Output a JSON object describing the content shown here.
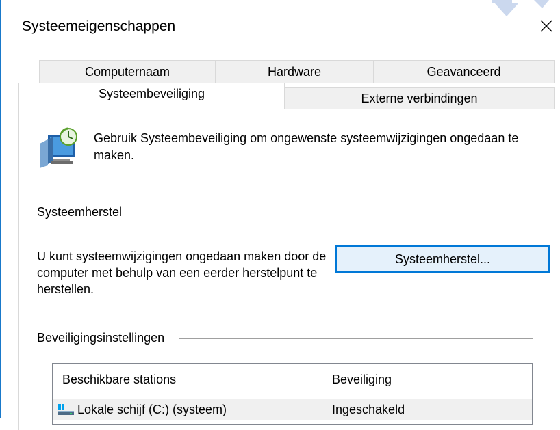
{
  "window": {
    "title": "Systeemeigenschappen"
  },
  "tabs": {
    "back_row": [
      "Computernaam",
      "Hardware",
      "Geavanceerd"
    ],
    "front_row": [
      "Systeembeveiliging",
      "Externe verbindingen"
    ],
    "active": "Systeembeveiliging"
  },
  "intro": {
    "text": "Gebruik Systeembeveiliging om ongewenste systeemwijzigingen ongedaan te maken."
  },
  "restore": {
    "group_label": "Systeemherstel",
    "description": "U kunt systeemwijzigingen ongedaan maken door de computer met behulp van een eerder herstelpunt te herstellen.",
    "button_label": "Systeemherstel..."
  },
  "protection": {
    "group_label": "Beveiligingsinstellingen",
    "columns": [
      "Beschikbare stations",
      "Beveiliging"
    ],
    "rows": [
      {
        "drive": "Lokale schijf (C:) (systeem)",
        "status": "Ingeschakeld"
      }
    ]
  },
  "icons": {
    "close": "close-icon",
    "intro": "system-protection-icon",
    "drive": "hard-drive-icon"
  },
  "colors": {
    "accent": "#0078d7",
    "button_bg": "#e5f1fb",
    "tab_bg": "#f0f0f0",
    "selected_row_bg": "#f0f0f0"
  }
}
